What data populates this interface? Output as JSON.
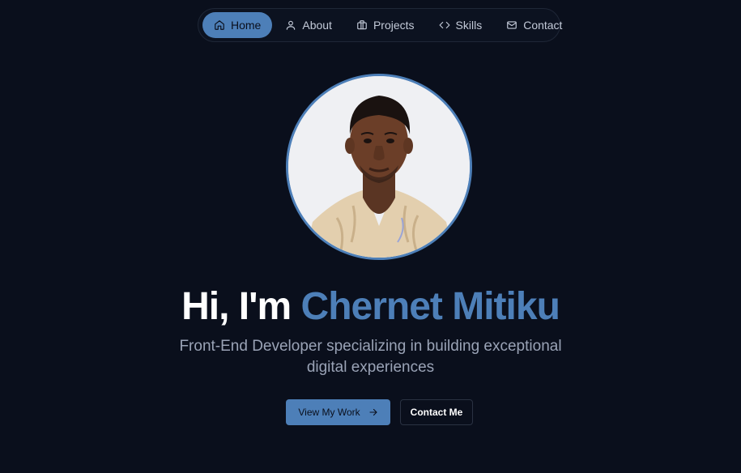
{
  "nav": {
    "items": [
      {
        "label": "Home",
        "icon": "home-icon",
        "active": true
      },
      {
        "label": "About",
        "icon": "user-icon",
        "active": false
      },
      {
        "label": "Projects",
        "icon": "briefcase-icon",
        "active": false
      },
      {
        "label": "Skills",
        "icon": "code-icon",
        "active": false
      },
      {
        "label": "Contact",
        "icon": "mail-icon",
        "active": false
      }
    ]
  },
  "hero": {
    "greeting": "Hi, I'm ",
    "name": "Chernet Mitiku",
    "subtitle": "Front-End Developer specializing in building exceptional digital experiences",
    "primary_button": "View My Work",
    "secondary_button": "Contact Me"
  },
  "colors": {
    "background": "#0a0f1c",
    "accent": "#4d7fb8",
    "text": "#ffffff",
    "muted": "#9aa3b6"
  }
}
